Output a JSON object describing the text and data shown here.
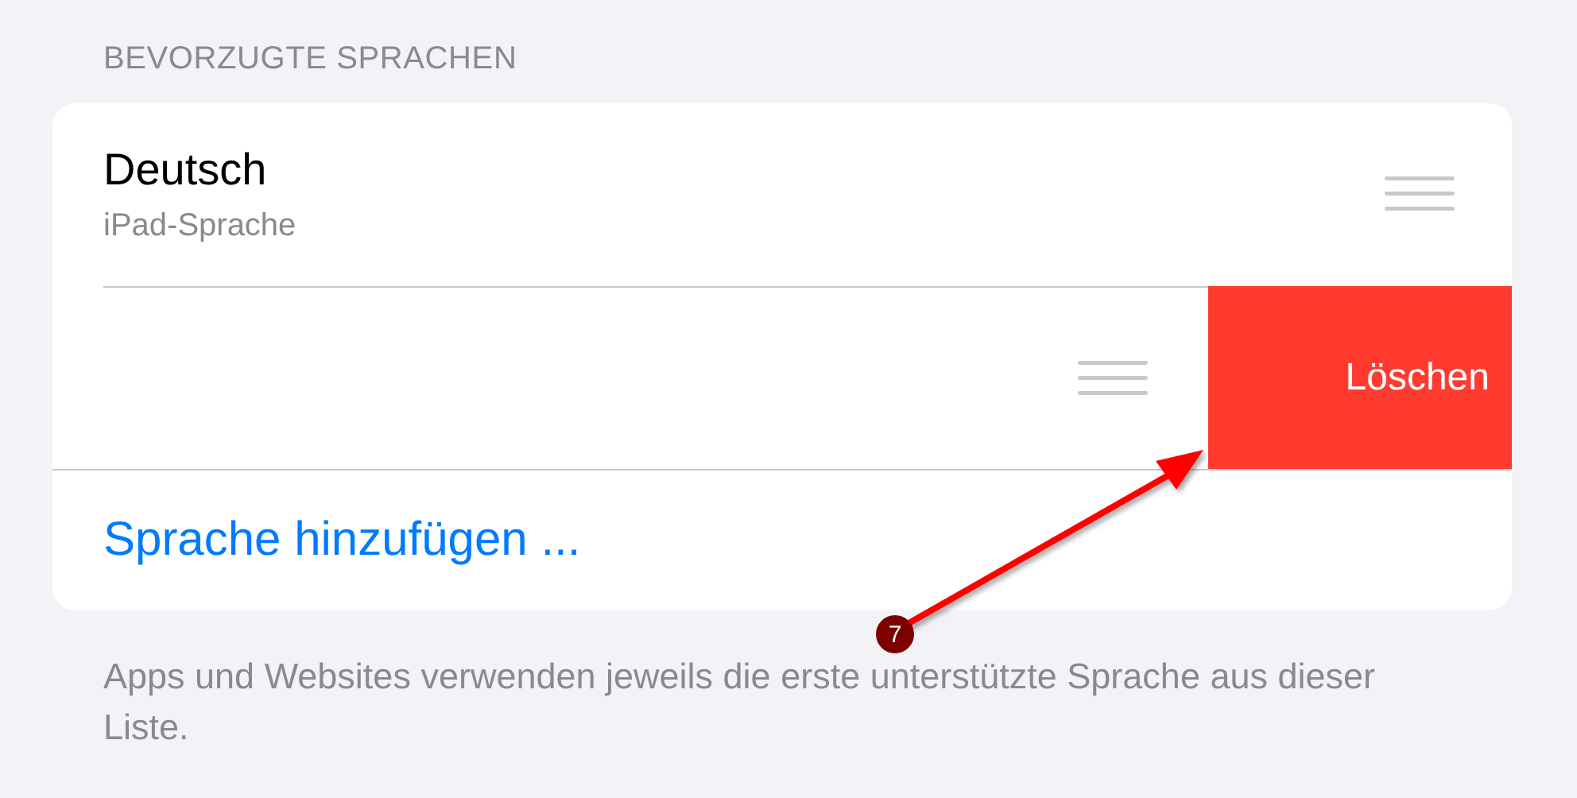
{
  "section_header": "BEVORZUGTE SPRACHEN",
  "languages": [
    {
      "kind": "normal",
      "name": "Deutsch",
      "subtitle": "iPad-Sprache"
    },
    {
      "kind": "swiped",
      "delete_label": "Löschen"
    }
  ],
  "add_language": "Sprache hinzufügen ...",
  "footer": "Apps und Websites verwenden jeweils die erste unterstützte Sprache aus dieser Liste.",
  "annotation": {
    "number": "7"
  }
}
